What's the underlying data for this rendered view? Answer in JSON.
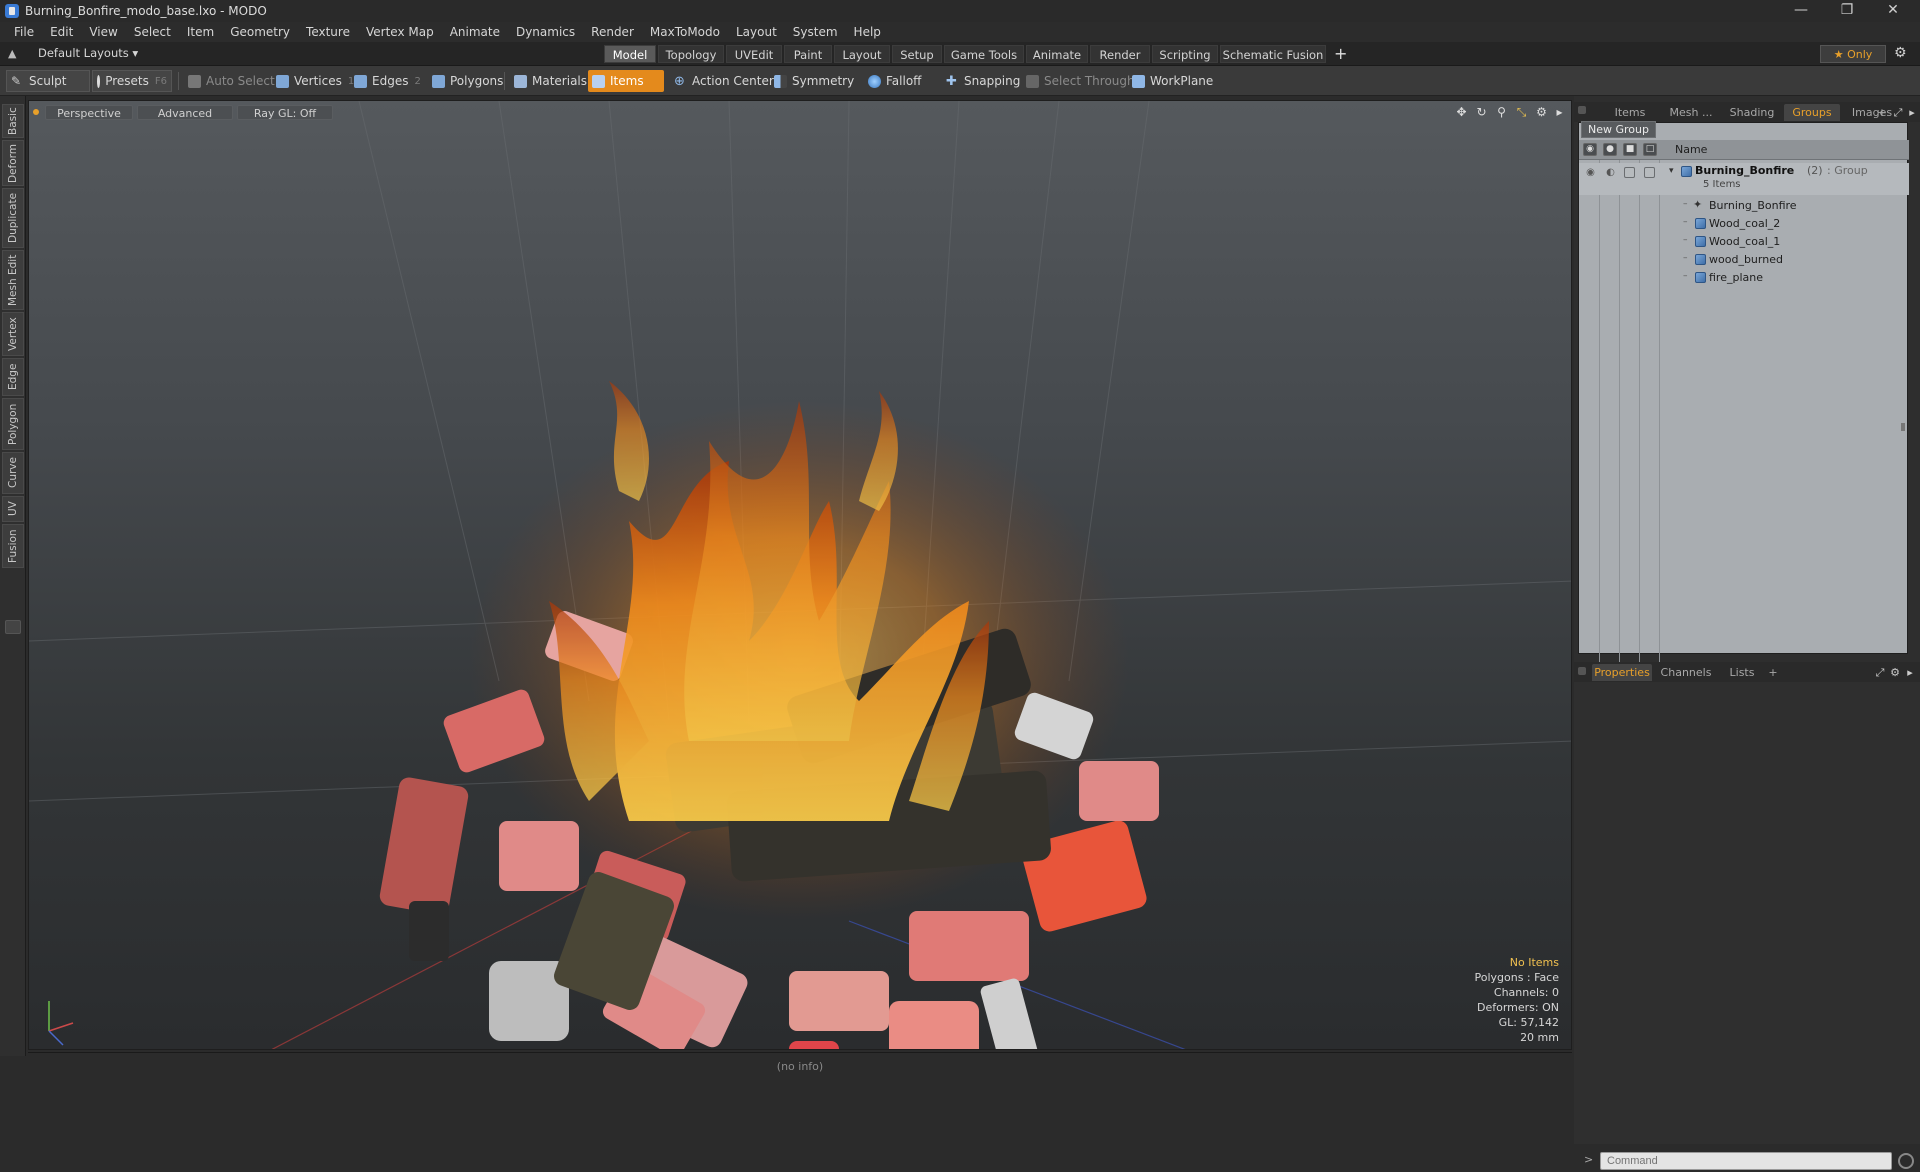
{
  "window": {
    "title": "Burning_Bonfire_modo_base.lxo - MODO"
  },
  "menu": [
    "File",
    "Edit",
    "View",
    "Select",
    "Item",
    "Geometry",
    "Texture",
    "Vertex Map",
    "Animate",
    "Dynamics",
    "Render",
    "MaxToModo",
    "Layout",
    "System",
    "Help"
  ],
  "layout": {
    "selector": "Default Layouts ▾",
    "tabs": [
      "Model",
      "Topology",
      "UVEdit",
      "Paint",
      "Layout",
      "Setup",
      "Game Tools",
      "Animate",
      "Render",
      "Scripting",
      "Schematic Fusion"
    ],
    "active_tab": "Model",
    "add": "+",
    "only_label": "★  Only"
  },
  "toolbar": {
    "sculpt": "Sculpt",
    "presets": "Presets",
    "presets_key": "F6",
    "auto_select": "Auto Select",
    "vertices": "Vertices",
    "vertices_num": "1",
    "edges": "Edges",
    "edges_num": "2",
    "polygons": "Polygons",
    "materials": "Materials",
    "items": "Items",
    "action_center": "Action Center",
    "symmetry": "Symmetry",
    "falloff": "Falloff",
    "snapping": "Snapping",
    "select_through": "Select Through",
    "workplane": "WorkPlane"
  },
  "left_tabs": [
    "Basic",
    "Deform",
    "Duplicate",
    "Mesh Edit",
    "Vertex",
    "Edge",
    "Polygon",
    "Curve",
    "UV",
    "Fusion"
  ],
  "viewport": {
    "view": "Perspective",
    "mode": "Advanced",
    "raygl": "Ray GL: Off",
    "stats": {
      "selection": "No Items",
      "polygons": "Polygons : Face",
      "channels": "Channels: 0",
      "deformers": "Deformers: ON",
      "gl": "GL: 57,142",
      "scale": "20 mm"
    }
  },
  "status": {
    "info": "(no info)"
  },
  "panel_top": {
    "tabs": [
      "Items",
      "Mesh ...",
      "Shading",
      "Groups",
      "Images"
    ],
    "active_tab": "Groups",
    "add": "+",
    "new_group": "New Group",
    "column_name": "Name",
    "group": {
      "name": "Burning_Bonfire",
      "count": "(2)",
      "type": ": Group",
      "sub": "5 Items"
    },
    "children": [
      "Burning_Bonfire",
      "Wood_coal_2",
      "Wood_coal_1",
      "wood_burned",
      "fire_plane"
    ]
  },
  "panel_bottom": {
    "tabs": [
      "Properties",
      "Channels",
      "Lists"
    ],
    "active_tab": "Properties",
    "add": "+"
  },
  "command": {
    "prompt": ">",
    "placeholder": "Command"
  }
}
